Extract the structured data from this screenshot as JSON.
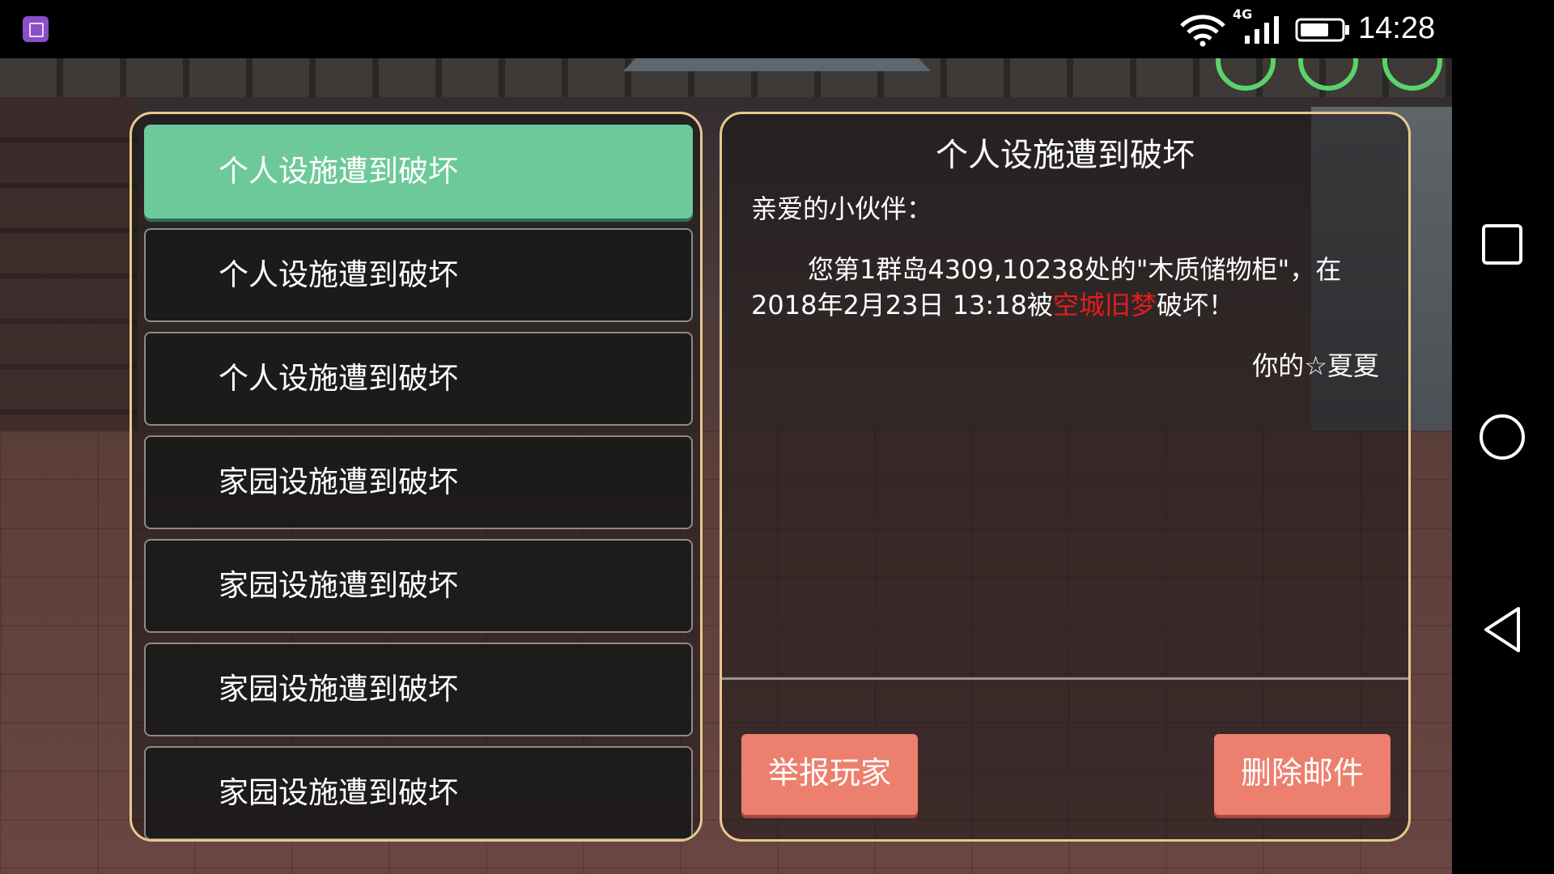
{
  "status_bar": {
    "time": "14:28",
    "network_type": "4G",
    "icons": [
      "app-notification-icon",
      "wifi-icon",
      "cell-signal-icon",
      "battery-icon"
    ]
  },
  "mail_list": {
    "items": [
      {
        "label": "个人设施遭到破坏",
        "selected": true
      },
      {
        "label": "个人设施遭到破坏",
        "selected": false
      },
      {
        "label": "个人设施遭到破坏",
        "selected": false
      },
      {
        "label": "家园设施遭到破坏",
        "selected": false
      },
      {
        "label": "家园设施遭到破坏",
        "selected": false
      },
      {
        "label": "家园设施遭到破坏",
        "selected": false
      },
      {
        "label": "家园设施遭到破坏",
        "selected": false
      }
    ]
  },
  "mail_detail": {
    "title": "个人设施遭到破坏",
    "greeting": "亲爱的小伙伴：",
    "body_before": "您第1群岛4309,10238处的\"木质储物柜\"，在2018年2月23日 13:18被",
    "attacker": "空城旧梦",
    "body_after": "破坏！",
    "signature": "你的☆夏夏"
  },
  "buttons": {
    "report_label": "举报玩家",
    "delete_label": "删除邮件"
  },
  "colors": {
    "selected_item": "#6dc99a",
    "panel_border": "#e8c88c",
    "action_button": "#ec7f6d",
    "attacker_name": "#e51c1c"
  },
  "nav_bar": {
    "icons": [
      "recent-apps-icon",
      "home-icon",
      "back-icon"
    ]
  }
}
